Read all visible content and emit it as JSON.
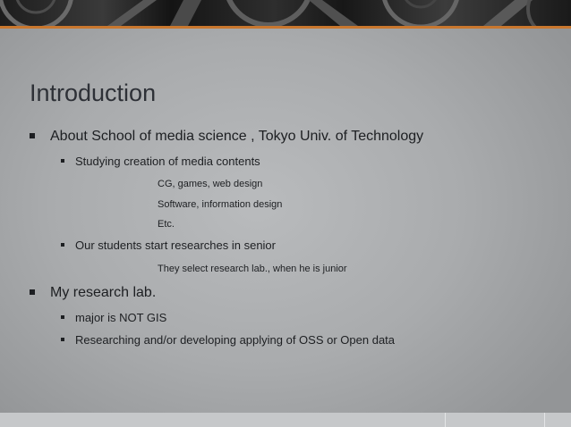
{
  "slide": {
    "title": "Introduction",
    "items": [
      {
        "level": 1,
        "bullet": true,
        "text": "About School of media science , Tokyo Univ. of Technology"
      },
      {
        "level": 2,
        "bullet": true,
        "text": "Studying creation of media contents"
      },
      {
        "level": 3,
        "bullet": false,
        "text": "CG, games, web design"
      },
      {
        "level": 3,
        "bullet": false,
        "text": "Software, information design"
      },
      {
        "level": 3,
        "bullet": false,
        "text": "Etc."
      },
      {
        "level": 2,
        "bullet": true,
        "text": "Our students start researches in senior"
      },
      {
        "level": 3,
        "bullet": false,
        "text": "They select research lab., when he is junior"
      },
      {
        "level": 1,
        "bullet": true,
        "text": "My research lab."
      },
      {
        "level": 2,
        "bullet": true,
        "text": "major is NOT GIS"
      },
      {
        "level": 2,
        "bullet": true,
        "text": "Researching and/or developing applying of OSS or Open data"
      }
    ]
  },
  "colors": {
    "accent": "#c9772e",
    "title": "#2e3137",
    "text": "#1d1f22"
  }
}
